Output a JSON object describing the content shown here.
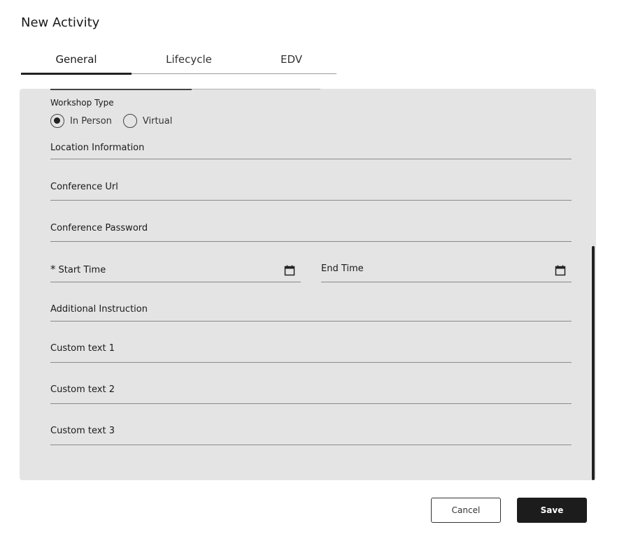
{
  "dialog": {
    "title": "New Activity"
  },
  "tabs": [
    {
      "label": "General",
      "active": true
    },
    {
      "label": "Lifecycle",
      "active": false
    },
    {
      "label": "EDV",
      "active": false
    }
  ],
  "form": {
    "workshop_type": {
      "label": "Workshop Type",
      "options": [
        {
          "label": "In Person",
          "selected": true
        },
        {
          "label": "Virtual",
          "selected": false
        }
      ]
    },
    "location_information": {
      "placeholder": "Location Information",
      "value": ""
    },
    "conference_url": {
      "placeholder": "Conference Url",
      "value": ""
    },
    "conference_password": {
      "placeholder": "Conference Password",
      "value": ""
    },
    "start_time": {
      "placeholder": "Start Time",
      "required_mark": "*",
      "value": "",
      "icon": "calendar-icon"
    },
    "end_time": {
      "placeholder": "End Time",
      "value": "",
      "icon": "calendar-icon"
    },
    "additional_instruction": {
      "placeholder": "Additional Instruction",
      "value": ""
    },
    "custom_text_1": {
      "placeholder": "Custom text 1",
      "value": ""
    },
    "custom_text_2": {
      "placeholder": "Custom text 2",
      "value": ""
    },
    "custom_text_3": {
      "placeholder": "Custom text 3",
      "value": ""
    }
  },
  "actions": {
    "cancel_label": "Cancel",
    "save_label": "Save"
  },
  "colors": {
    "panel_bg": "#e4e4e4",
    "primary_button": "#1c1c1c",
    "text": "#1a1a1a"
  }
}
